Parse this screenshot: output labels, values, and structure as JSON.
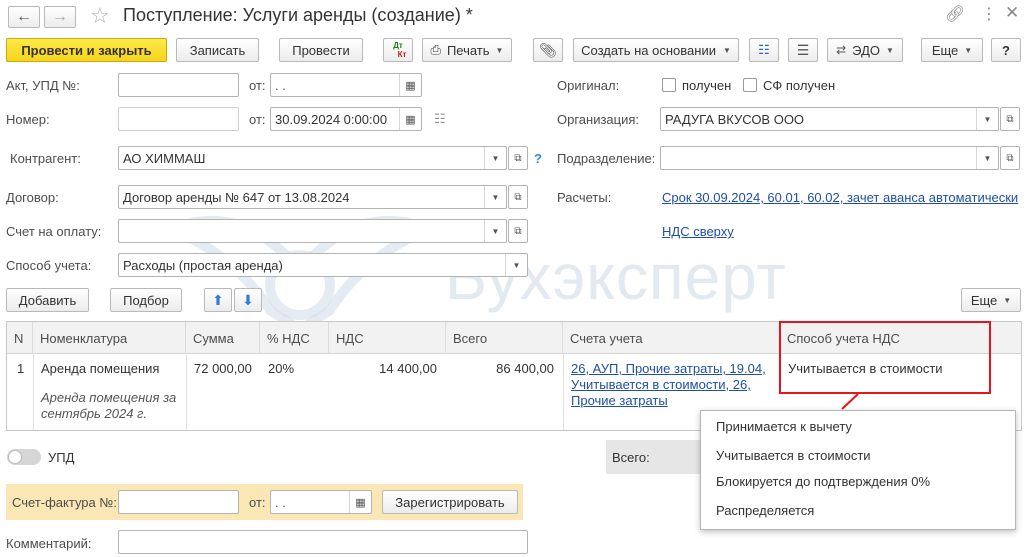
{
  "window": {
    "title": "Поступление: Услуги аренды (создание) *"
  },
  "toolbar": {
    "post_and_close": "Провести и закрыть",
    "save": "Записать",
    "post": "Провести",
    "dt_kt_top": "Дт",
    "dt_kt_bottom": "Кт",
    "print": "Печать",
    "create_based_on": "Создать на основании",
    "edo": "ЭДО",
    "more": "Еще",
    "help": "?"
  },
  "form": {
    "act_label": "Акт, УПД №:",
    "act_value": "",
    "from_label": "от:",
    "act_date": " .  .",
    "number_label": "Номер:",
    "number_value": "",
    "number_from_label": "от:",
    "number_date": "30.09.2024  0:00:00",
    "original_label": "Оригинал:",
    "received_label": "получен",
    "sf_received_label": "СФ получен",
    "org_label": "Организация:",
    "org_value": "РАДУГА ВКУСОВ ООО",
    "counterparty_label": "Контрагент:",
    "counterparty_value": "АО ХИММАШ",
    "help_mark": "?",
    "division_label": "Подразделение:",
    "division_value": "",
    "contract_label": "Договор:",
    "contract_value": "Договор аренды № 647 от 13.08.2024",
    "settlements_label": "Расчеты:",
    "settlements_link": "Срок 30.09.2024, 60.01, 60.02, зачет аванса автоматически",
    "invoice_label": "Счет на оплату:",
    "invoice_value": "",
    "vat_link": "НДС сверху",
    "accounting_label": "Способ учета:",
    "accounting_value": "Расходы (простая аренда)"
  },
  "table_toolbar": {
    "add": "Добавить",
    "pick": "Подбор",
    "more": "Еще"
  },
  "table": {
    "headers": [
      "N",
      "Номенклатура",
      "Сумма",
      "% НДС",
      "НДС",
      "Всего",
      "Счета учета",
      "Способ учета НДС"
    ],
    "row": {
      "n": "1",
      "item": "Аренда помещения",
      "item_note_1": "Аренда помещения за",
      "item_note_2": "сентябрь 2024 г.",
      "sum": "72 000,00",
      "vat_rate": "20%",
      "vat": "14 400,00",
      "total": "86 400,00",
      "accounts_1": "26, АУП, Прочие затраты, 19.04,",
      "accounts_2": "Учитывается в стоимости, 26,",
      "accounts_3": "Прочие затраты",
      "vat_method": "Учитывается в стоимости"
    }
  },
  "dropdown": {
    "options": [
      "Принимается к вычету",
      "Учитывается в стоимости",
      "Блокируется до подтверждения 0%",
      "Распределяется"
    ]
  },
  "footer": {
    "upd_label": "УПД",
    "total_label": "Всего:",
    "sf_label": "Счет-фактура №:",
    "sf_value": "",
    "sf_from_label": "от:",
    "sf_date": " .  .",
    "register": "Зарегистрировать",
    "comment_label": "Комментарий:",
    "comment_value": ""
  },
  "watermark": {
    "text": "Бухэксперт"
  },
  "colors": {
    "primary_button": "#f6d51a",
    "link": "#1f4fa8",
    "highlight_border": "#e8141b",
    "invoice_band": "#fbe7b5"
  }
}
